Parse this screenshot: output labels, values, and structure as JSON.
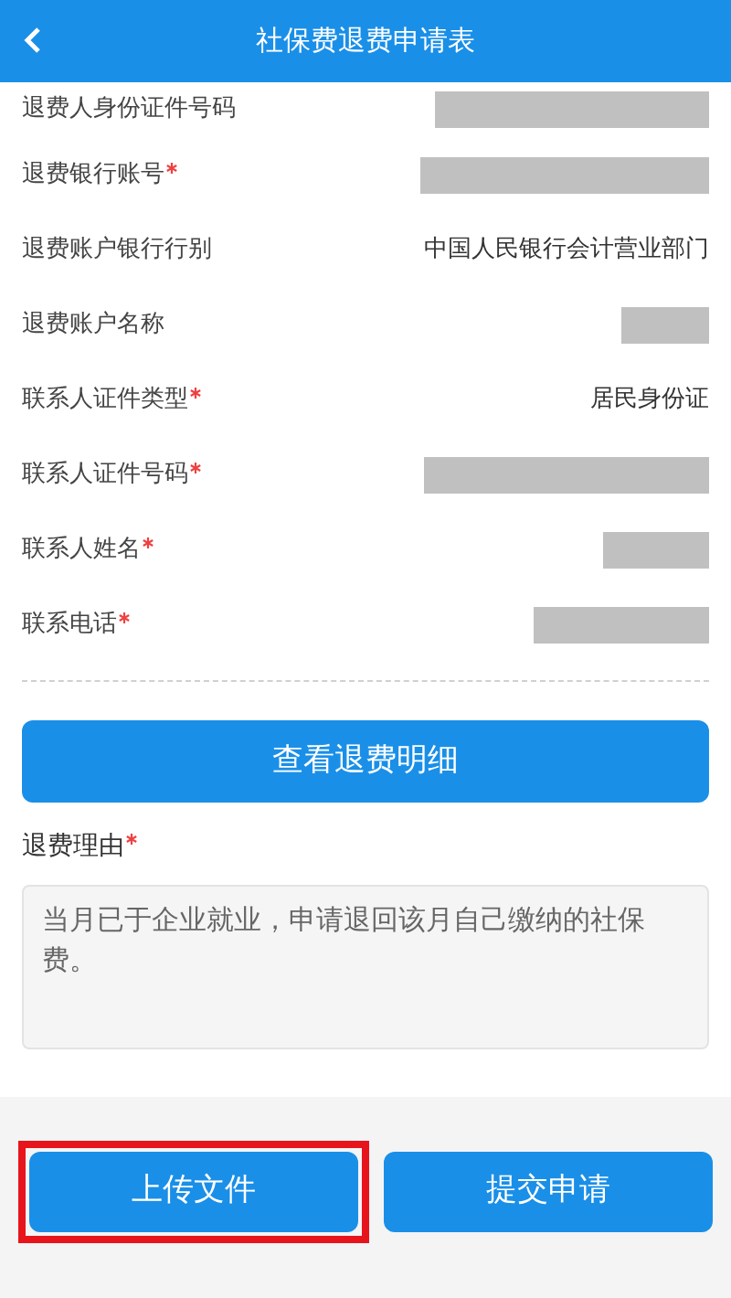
{
  "header": {
    "title": "社保费退费申请表"
  },
  "fields": [
    {
      "label": "退费人身份证件号码",
      "required": false,
      "kind": "redacted"
    },
    {
      "label": "退费银行账号",
      "required": true,
      "kind": "redacted"
    },
    {
      "label": "退费账户银行行别",
      "required": false,
      "kind": "text",
      "value": "中国人民银行会计营业部门"
    },
    {
      "label": "退费账户名称",
      "required": false,
      "kind": "redacted"
    },
    {
      "label": "联系人证件类型",
      "required": true,
      "kind": "text",
      "value": "居民身份证"
    },
    {
      "label": "联系人证件号码",
      "required": true,
      "kind": "redacted"
    },
    {
      "label": "联系人姓名",
      "required": true,
      "kind": "redacted"
    },
    {
      "label": "联系电话",
      "required": true,
      "kind": "redacted"
    }
  ],
  "detail_button": "查看退费明细",
  "reason": {
    "label": "退费理由",
    "required": true,
    "value": "当月已于企业就业，申请退回该月自己缴纳的社保费。"
  },
  "footer_buttons": [
    {
      "label": "上传文件",
      "highlighted": true
    },
    {
      "label": "提交申请",
      "highlighted": false
    }
  ]
}
